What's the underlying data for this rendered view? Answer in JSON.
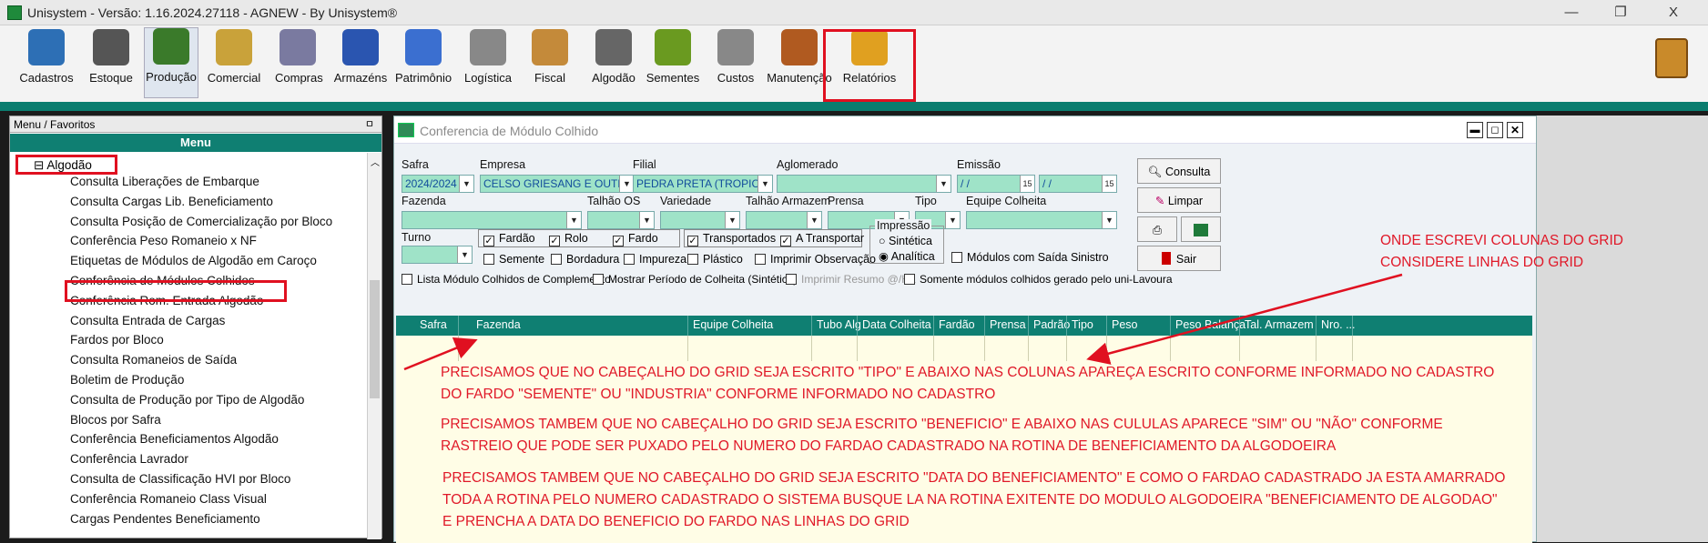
{
  "window": {
    "title": "Unisystem - Versão: 1.16.2024.27118 - AGNEW - By Unisystem®",
    "min": "—",
    "max": "❐",
    "close": "X"
  },
  "toolbar": [
    {
      "label": "Cadastros",
      "icon": "cadastros-icon"
    },
    {
      "label": "Estoque",
      "icon": "barcode-icon"
    },
    {
      "label": "Produção",
      "icon": "tractor-icon"
    },
    {
      "label": "Comercial",
      "icon": "money-icon"
    },
    {
      "label": "Compras",
      "icon": "pencil-icon"
    },
    {
      "label": "Armazéns",
      "icon": "house-icon"
    },
    {
      "label": "Patrimônio",
      "icon": "chair-icon"
    },
    {
      "label": "Logística",
      "icon": "truck-icon"
    },
    {
      "label": "Fiscal",
      "icon": "person-icon"
    },
    {
      "label": "Algodão",
      "icon": "cotton-icon"
    },
    {
      "label": "Sementes",
      "icon": "seeds-icon"
    },
    {
      "label": "Custos",
      "icon": "coins-icon"
    },
    {
      "label": "Manutenção",
      "icon": "tools-icon"
    },
    {
      "label": "Relatórios",
      "icon": "reports-icon"
    }
  ],
  "left": {
    "favs": "Menu / Favoritos",
    "pin": "ㅁ",
    "header": "Menu",
    "root": "Algodão",
    "items": [
      "Consulta Liberações de Embarque",
      "Consulta Cargas Lib. Beneficiamento",
      "Consulta Posição de Comercialização por Bloco",
      "Conferência Peso Romaneio x NF",
      "Etiquetas de Módulos de Algodão em Caroço",
      "Conferência de Módulos Colhidos",
      "Conferência Rom. Entrada Algodão",
      "Consulta Entrada de Cargas",
      "Fardos por Bloco",
      "Consulta Romaneios de Saída",
      "Boletim de Produção",
      "Consulta de Produção por Tipo de Algodão",
      "Blocos por Safra",
      "Conferência Beneficiamentos Algodão",
      "Conferência Lavrador",
      "Consulta de Classificação HVI por Bloco",
      "Conferência Romaneio Class Visual",
      "Cargas Pendentes Beneficiamento"
    ]
  },
  "form": {
    "title": "Conferencia de Módulo Colhido",
    "safra_l": "Safra",
    "safra_v": "2024/2024",
    "empresa_l": "Empresa",
    "empresa_v": "CELSO GRIESANG E OUTRO",
    "filial_l": "Filial",
    "filial_v": "PEDRA PRETA (TROPICAL",
    "aglo_l": "Aglomerado",
    "emissao_l": "Emissão",
    "date1": "/ /",
    "date2": "/ /",
    "fazenda_l": "Fazenda",
    "talhao_l": "Talhão OS",
    "variedade_l": "Variedade",
    "talhaoarm_l": "Talhão Armazem",
    "prensa_l": "Prensa",
    "tipo_l": "Tipo",
    "equipe_l": "Equipe Colheita",
    "turno_l": "Turno",
    "fardao": "Fardão",
    "rolo": "Rolo",
    "fardo": "Fardo",
    "transportados": "Transportados",
    "atransportar": "A Transportar",
    "semente": "Semente",
    "bordadura": "Bordadura",
    "impureza": "Impureza",
    "plastico": "Plástico",
    "imprimirobs": "Imprimir Observação",
    "impressao": "Impressão",
    "sintetica": "Sintética",
    "analitica": "Analítica",
    "modulos_sinistro": "Módulos com Saída Sinistro",
    "lista": "Lista Módulo Colhidos de Complemento",
    "mostrar": "Mostrar Período de Colheita (Sintético)",
    "imprimir_resumo": "Imprimir Resumo @/Ha",
    "somente": "Somente módulos colhidos gerado pelo uni-Lavoura",
    "consultar": "Consulta",
    "limpar": "Limpar",
    "sair": "Sair",
    "check": "✓"
  },
  "grid": {
    "cols": [
      "Safra",
      "Fazenda",
      "Equipe Colheita",
      "Tubo Alg",
      "Data Colheita",
      "Fardão",
      "Prensa",
      "Padrão",
      "Tipo",
      "Peso",
      "Peso Balança",
      "Tal. Armazem",
      "Nro. ..."
    ]
  },
  "notes": [
    "ONDE ESCREVI COLUNAS DO GRID",
    "CONSIDERE LINHAS DO GRID",
    "PRECISAMOS QUE NO CABEÇALHO DO GRID SEJA ESCRITO \"TIPO\" E ABAIXO NAS COLUNAS APAREÇA ESCRITO CONFORME INFORMADO NO CADASTRO",
    "DO FARDO \"SEMENTE\" OU \"INDUSTRIA\" CONFORME INFORMADO NO CADASTRO",
    "PRECISAMOS TAMBEM QUE NO CABEÇALHO DO GRID SEJA ESCRITO \"BENEFICIO\" E ABAIXO NAS CULULAS APARECE \"SIM\" OU \"NÃO\" CONFORME",
    "RASTREIO QUE PODE SER PUXADO PELO NUMERO DO FARDAO CADASTRADO NA ROTINA DE BENEFICIAMENTO DA ALGODOEIRA",
    "PRECISAMOS TAMBEM QUE NO CABEÇALHO DO GRID SEJA ESCRITO \"DATA DO BENEFICIAMENTO\" E COMO O FARDAO CADASTRADO JA ESTA AMARRADO",
    "TODA A ROTINA PELO NUMERO CADASTRADO O SISTEMA BUSQUE LA NA ROTINA EXITENTE DO MODULO ALGODOEIRA \"BENEFICIAMENTO DE ALGODAO\"",
    "E PRENCHA A DATA DO BENEFICIO DO FARDO NAS LINHAS DO GRID"
  ]
}
